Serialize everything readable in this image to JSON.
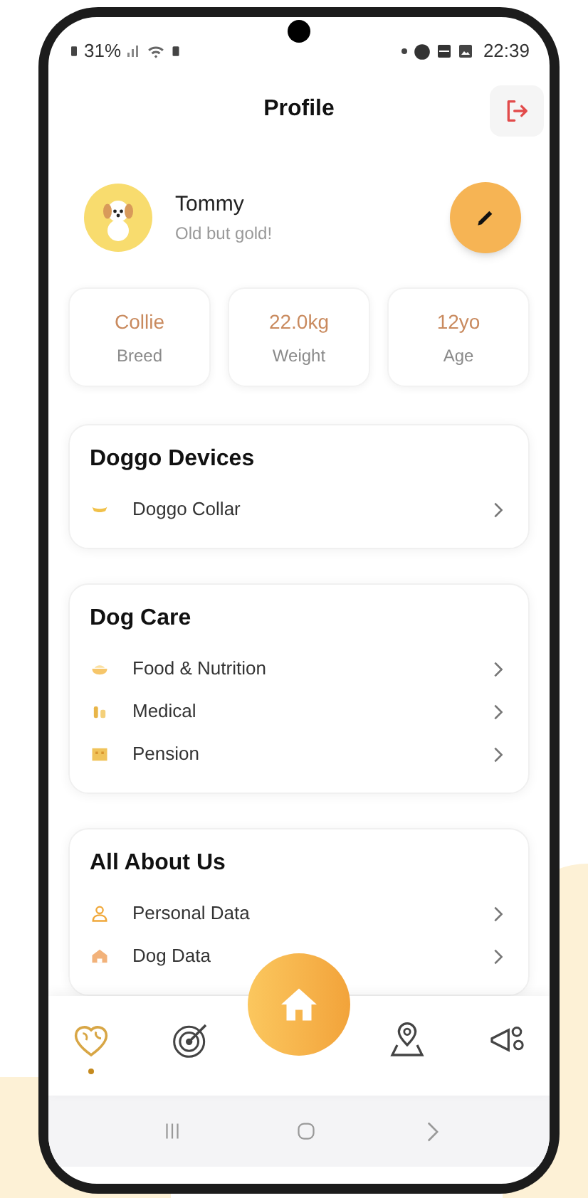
{
  "status_bar": {
    "battery": "31%",
    "time": "22:39"
  },
  "header": {
    "title": "Profile"
  },
  "profile": {
    "name": "Tommy",
    "tagline": "Old but gold!"
  },
  "stats": [
    {
      "value": "Collie",
      "label": "Breed"
    },
    {
      "value": "22.0kg",
      "label": "Weight"
    },
    {
      "value": "12yo",
      "label": "Age"
    }
  ],
  "sections": [
    {
      "title": "Doggo Devices",
      "items": [
        {
          "label": "Doggo Collar"
        }
      ]
    },
    {
      "title": "Dog Care",
      "items": [
        {
          "label": "Food & Nutrition"
        },
        {
          "label": "Medical"
        },
        {
          "label": "Pension"
        }
      ]
    },
    {
      "title": "All About Us",
      "items": [
        {
          "label": "Personal Data"
        },
        {
          "label": "Dog Data"
        }
      ]
    }
  ],
  "bottom_nav": [
    {
      "selected": true
    },
    {
      "selected": false
    },
    {
      "selected": false
    },
    {
      "selected": false
    }
  ]
}
